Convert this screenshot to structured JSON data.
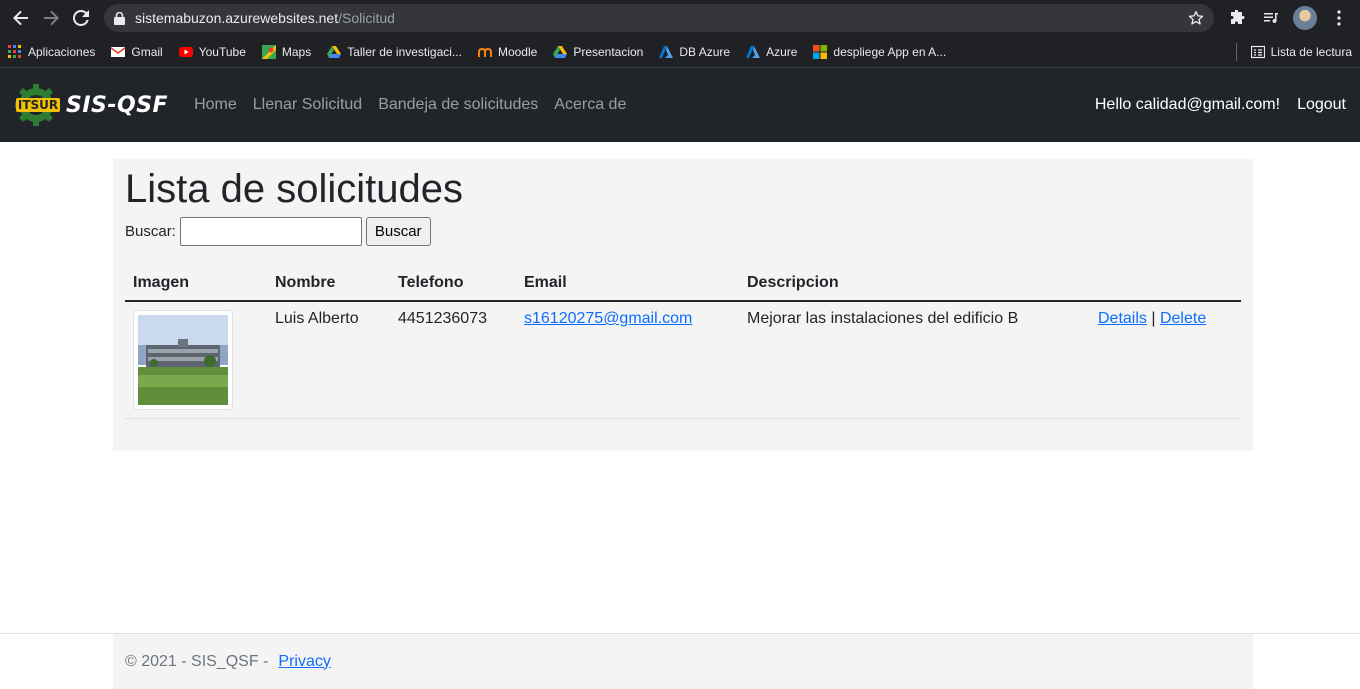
{
  "browser": {
    "url_host": "sistemabuzon.azurewebsites.net",
    "url_path": "/Solicitud",
    "bookmarks": [
      {
        "label": "Aplicaciones",
        "icon": "apps-grid-icon",
        "color": "#ea4335"
      },
      {
        "label": "Gmail",
        "icon": "gmail-icon",
        "color": "#ea4335"
      },
      {
        "label": "YouTube",
        "icon": "youtube-icon",
        "color": "#ff0000"
      },
      {
        "label": "Maps",
        "icon": "maps-icon",
        "color": "#34a853"
      },
      {
        "label": "Taller de investigaci...",
        "icon": "drive-icon",
        "color": "#fbbc04"
      },
      {
        "label": "Moodle",
        "icon": "moodle-icon",
        "color": "#f98012"
      },
      {
        "label": "Presentacion",
        "icon": "drive-icon",
        "color": "#fbbc04"
      },
      {
        "label": "DB Azure",
        "icon": "azure-icon",
        "color": "#0078d4"
      },
      {
        "label": "Azure",
        "icon": "azure-icon",
        "color": "#0078d4"
      },
      {
        "label": "despliege App en A...",
        "icon": "microsoft-icon",
        "color": "#f25022"
      }
    ],
    "reading_list": "Lista de lectura"
  },
  "navbar": {
    "brand": "SIS-QSF",
    "links": [
      "Home",
      "Llenar Solicitud",
      "Bandeja de solicitudes",
      "Acerca de"
    ],
    "hello": "Hello calidad@gmail.com!",
    "logout": "Logout"
  },
  "main": {
    "title": "Lista de solicitudes",
    "search_label": "Buscar:",
    "search_value": "",
    "search_button": "Buscar",
    "columns": [
      "Imagen",
      "Nombre",
      "Telefono",
      "Email",
      "Descripcion"
    ],
    "rows": [
      {
        "nombre": "Luis Alberto",
        "telefono": "4451236073",
        "email": "s16120275@gmail.com",
        "descripcion": "Mejorar las instalaciones del edificio B",
        "details": "Details",
        "separator": "|",
        "delete": "Delete"
      }
    ]
  },
  "footer": {
    "copyright": "© 2021 - SIS_QSF -",
    "privacy": "Privacy"
  }
}
